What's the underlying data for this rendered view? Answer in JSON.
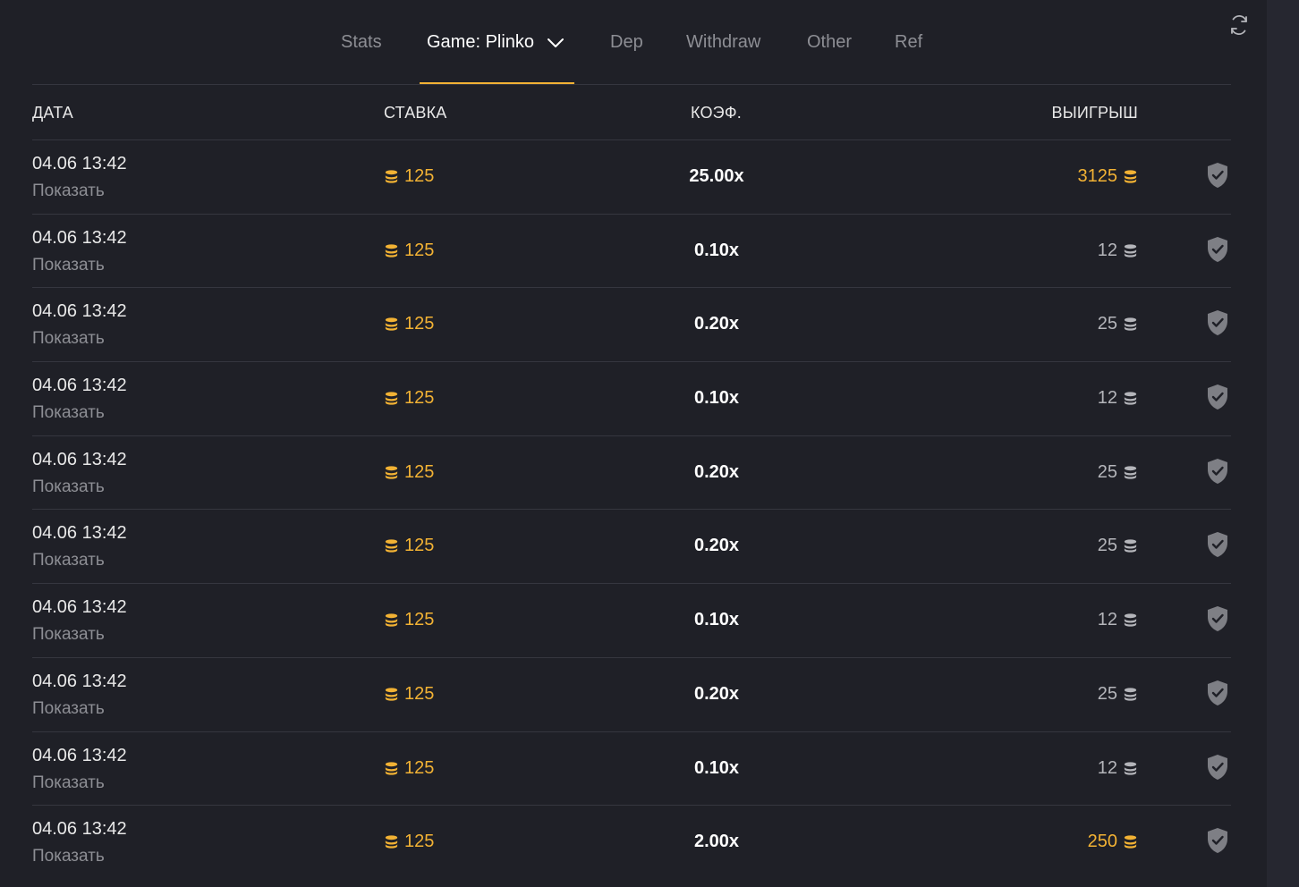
{
  "tabs": [
    {
      "label": "Stats"
    },
    {
      "label": "Game: Plinko"
    },
    {
      "label": "Dep"
    },
    {
      "label": "Withdraw"
    },
    {
      "label": "Other"
    },
    {
      "label": "Ref"
    }
  ],
  "columns": {
    "date": "ДАТА",
    "bet": "СТАВКА",
    "coef": "КОЭФ.",
    "win": "ВЫИГРЫШ"
  },
  "rows": [
    {
      "date": "04.06 13:42",
      "show": "Показать",
      "bet": "125",
      "coef": "25.00x",
      "win": "3125",
      "win_highlight": true
    },
    {
      "date": "04.06 13:42",
      "show": "Показать",
      "bet": "125",
      "coef": "0.10x",
      "win": "12",
      "win_highlight": false
    },
    {
      "date": "04.06 13:42",
      "show": "Показать",
      "bet": "125",
      "coef": "0.20x",
      "win": "25",
      "win_highlight": false
    },
    {
      "date": "04.06 13:42",
      "show": "Показать",
      "bet": "125",
      "coef": "0.10x",
      "win": "12",
      "win_highlight": false
    },
    {
      "date": "04.06 13:42",
      "show": "Показать",
      "bet": "125",
      "coef": "0.20x",
      "win": "25",
      "win_highlight": false
    },
    {
      "date": "04.06 13:42",
      "show": "Показать",
      "bet": "125",
      "coef": "0.20x",
      "win": "25",
      "win_highlight": false
    },
    {
      "date": "04.06 13:42",
      "show": "Показать",
      "bet": "125",
      "coef": "0.10x",
      "win": "12",
      "win_highlight": false
    },
    {
      "date": "04.06 13:42",
      "show": "Показать",
      "bet": "125",
      "coef": "0.20x",
      "win": "25",
      "win_highlight": false
    },
    {
      "date": "04.06 13:42",
      "show": "Показать",
      "bet": "125",
      "coef": "0.10x",
      "win": "12",
      "win_highlight": false
    },
    {
      "date": "04.06 13:42",
      "show": "Показать",
      "bet": "125",
      "coef": "2.00x",
      "win": "250",
      "win_highlight": true
    }
  ],
  "colors": {
    "background": "#1f2027",
    "accent": "#f2b234",
    "muted": "#8d8e94",
    "divider": "#35363f"
  },
  "icons": {
    "refresh": "refresh-icon",
    "chevron": "chevron-down-icon",
    "coin": "coin-stack-icon",
    "shield": "shield-check-icon"
  }
}
